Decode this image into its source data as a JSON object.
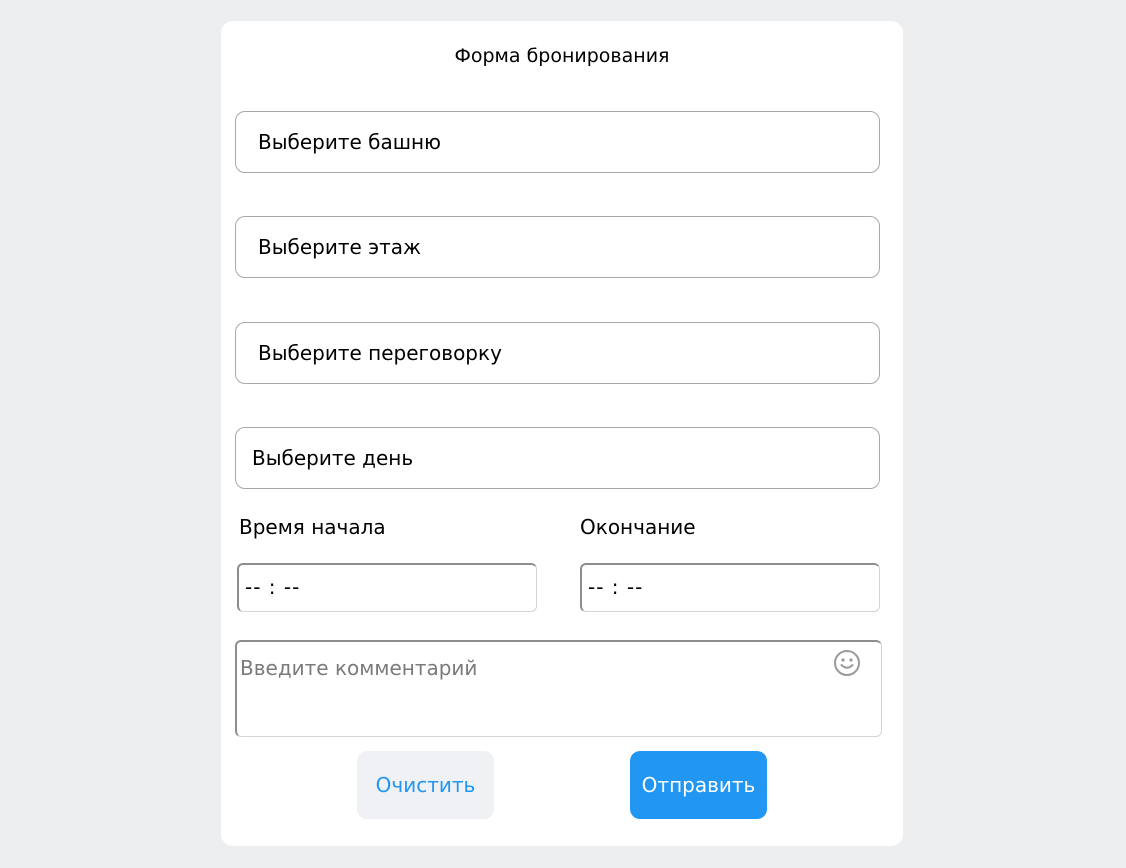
{
  "form": {
    "title": "Форма бронирования",
    "tower_select": "Выберите башню",
    "floor_select": "Выберите этаж",
    "room_select": "Выберите переговорку",
    "day_select": "Выберите день",
    "start_time_label": "Время начала",
    "end_time_label": "Окончание",
    "start_time_value": "-- : --",
    "end_time_value": "-- : --",
    "comment_placeholder": "Введите комментарий",
    "emoji_icon": "smile-icon",
    "clear_label": "Очистить",
    "submit_label": "Отправить"
  },
  "colors": {
    "accent": "#2196f3",
    "page_background": "#edeef0",
    "secondary_button": "#eff1f5"
  }
}
